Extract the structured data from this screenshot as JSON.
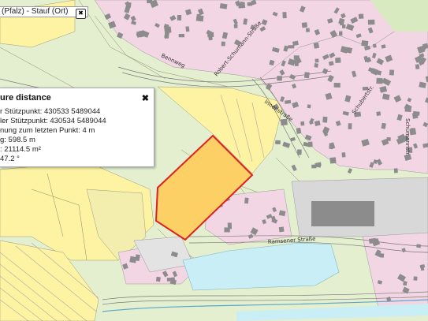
{
  "location": {
    "text": "(Pfalz) - Stauf (Ort)"
  },
  "measure_panel": {
    "title": "ure distance",
    "close_symbol": "✖",
    "lines": [
      "r Stützpunkt: 430533 5489044",
      "ler Stützpunkt: 430534 5489044",
      "nung zum letzten Punkt: 4 m",
      "g: 598.5 m",
      ": 21114.5 m²",
      " 47.2 °"
    ]
  },
  "streets": {
    "bennweg": "Bennweg",
    "robert_schumann": "Robert-Schumann-Straße",
    "innenstr": "Innenstraße",
    "schubertstr": "Schubertstr.",
    "schumannstr": "Schumannstr.",
    "ramsener": "Ramsener Straße"
  },
  "colors": {
    "parcel_fill": "#fcd065",
    "parcel_outline": "#e02020",
    "residential": "#f3d6e3",
    "building": "#8c8c8c",
    "water": "#c9eef6",
    "agriculture": "#fef3a0",
    "grass": "#d8ebbf"
  }
}
